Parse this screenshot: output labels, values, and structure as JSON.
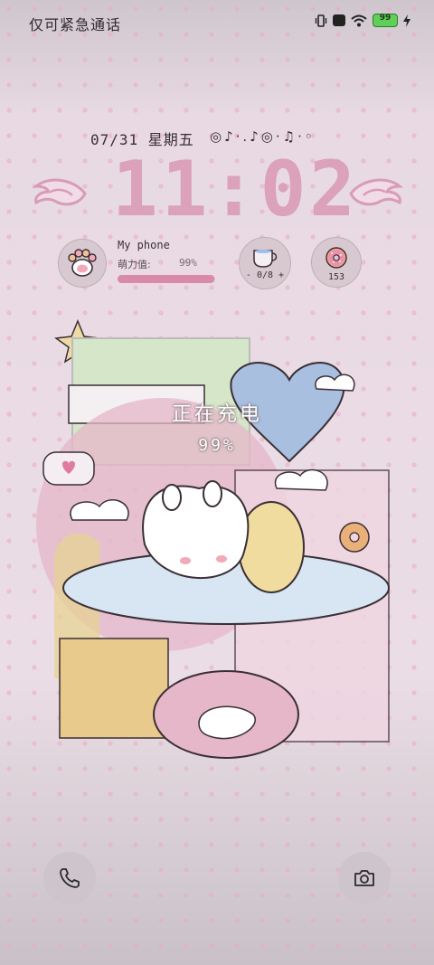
{
  "status_bar": {
    "carrier_text": "仅可紧急通话",
    "battery_level": "99",
    "icons": [
      "vibrate-icon",
      "notification-icon",
      "wifi-icon",
      "battery-icon",
      "charging-bolt-icon"
    ]
  },
  "lock_screen": {
    "date": "07/31 星期五",
    "time": "11:02",
    "profile": {
      "name": "My phone",
      "cute_label": "萌力值:",
      "cute_value": "99%",
      "cute_fraction": 0.99
    },
    "cup_widget": {
      "icon": "teacup-icon",
      "count": "- 0/8 +"
    },
    "donut_widget": {
      "icon": "donut-icon",
      "count": "153"
    },
    "charging": {
      "title": "正在充电",
      "percent": "99%"
    }
  },
  "shortcuts": {
    "left": "phone-icon",
    "right": "camera-icon"
  },
  "colors": {
    "clock": "#dca2bc",
    "accent_pink": "#d88aa8",
    "background": "#e9dbe3",
    "battery_green": "#5fcf57"
  }
}
